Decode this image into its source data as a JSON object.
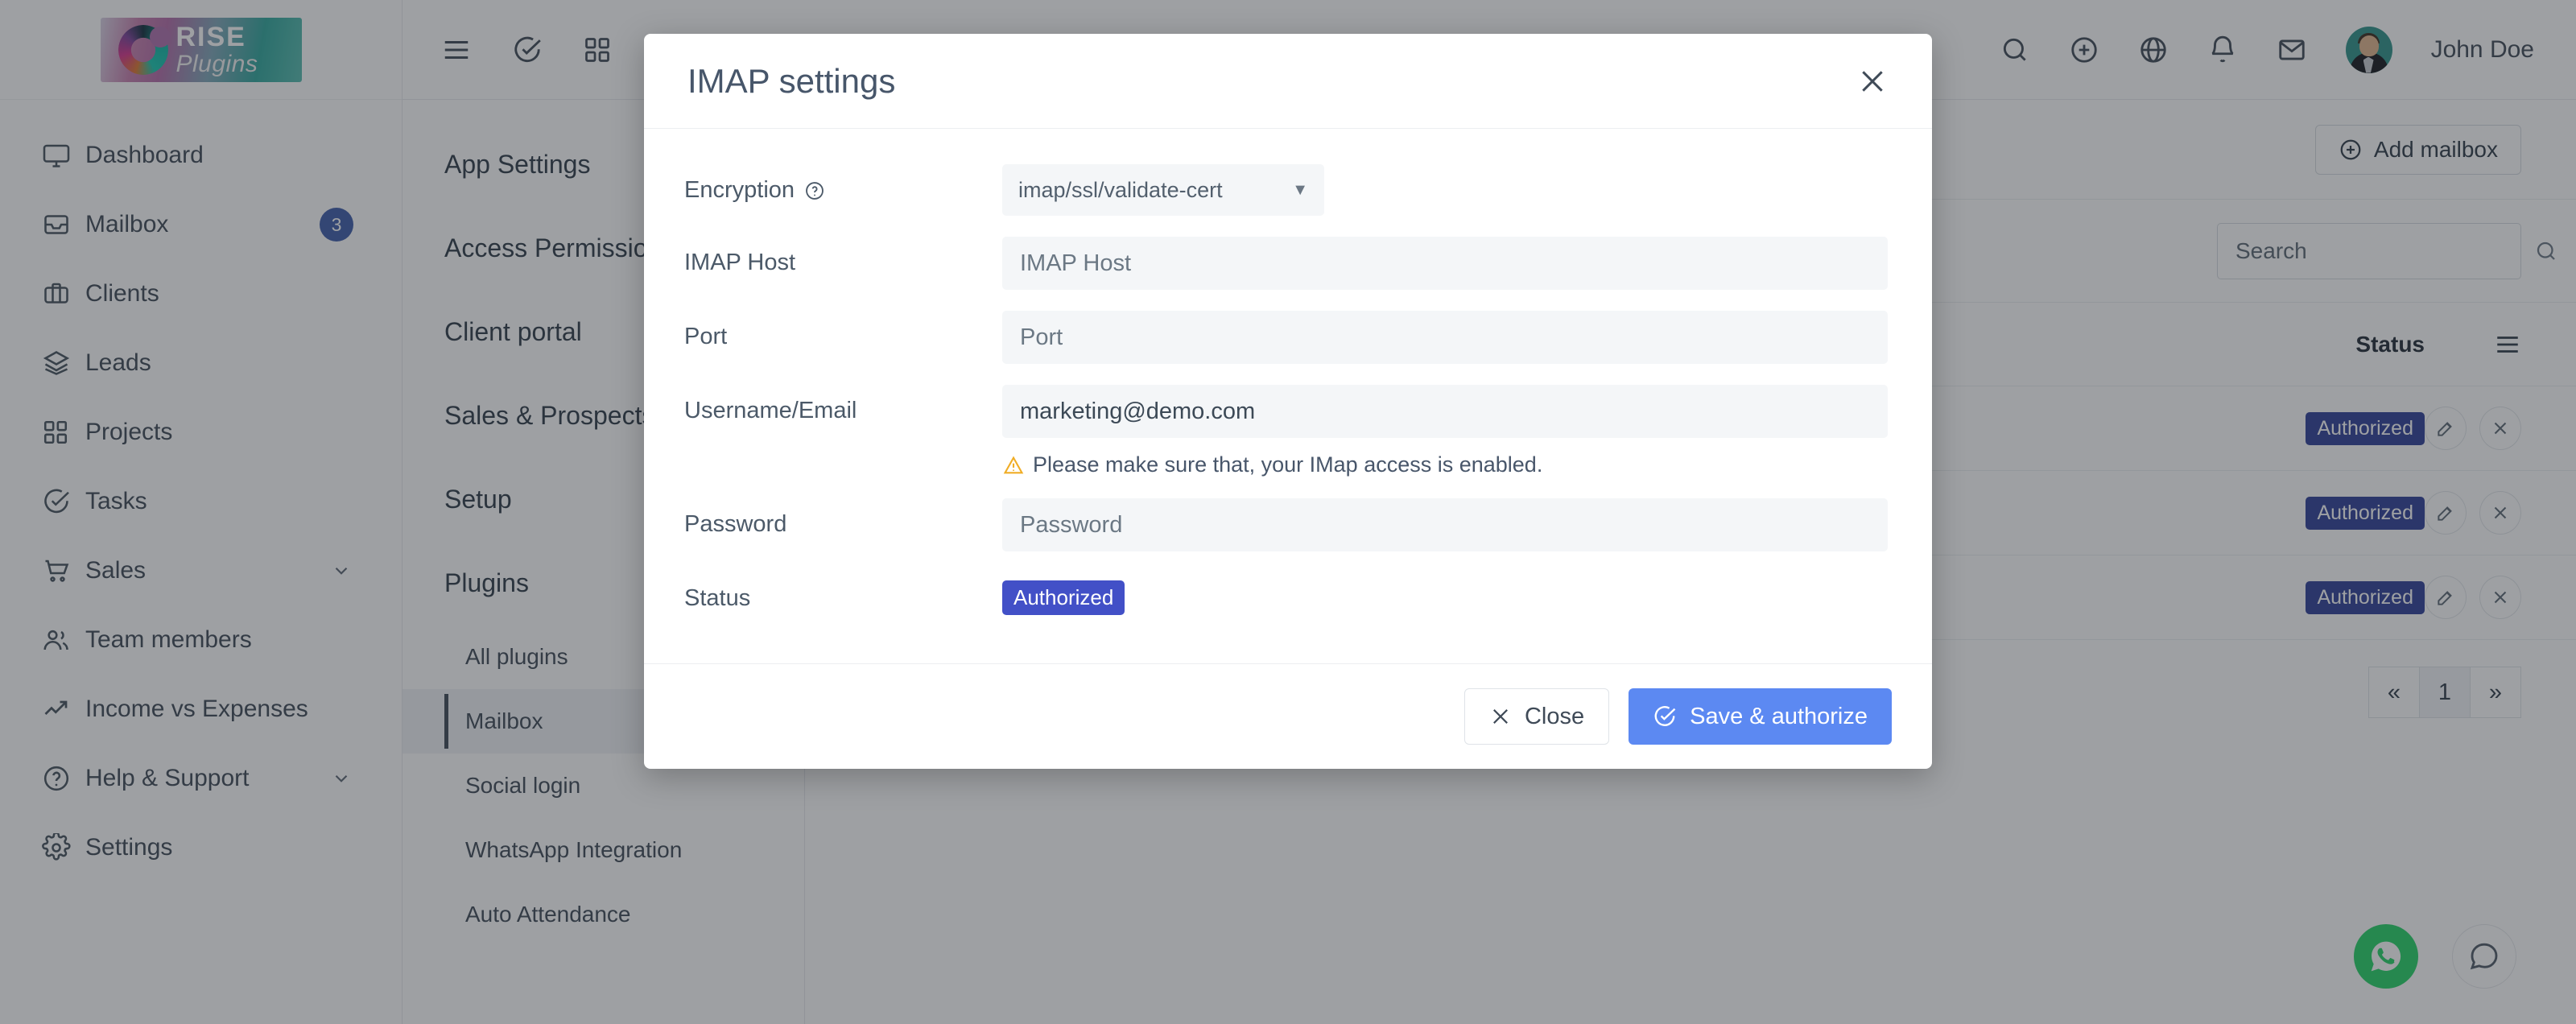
{
  "brand": {
    "name_top": "RISE",
    "name_bottom": "Plugins"
  },
  "sidebar": {
    "items": [
      {
        "label": "Dashboard",
        "icon": "monitor-icon",
        "badge": null,
        "caret": false
      },
      {
        "label": "Mailbox",
        "icon": "inbox-icon",
        "badge": "3",
        "caret": false
      },
      {
        "label": "Clients",
        "icon": "briefcase-icon",
        "badge": null,
        "caret": false
      },
      {
        "label": "Leads",
        "icon": "layers-icon",
        "badge": null,
        "caret": false
      },
      {
        "label": "Projects",
        "icon": "grid-icon",
        "badge": null,
        "caret": false
      },
      {
        "label": "Tasks",
        "icon": "check-circle-icon",
        "badge": null,
        "caret": false
      },
      {
        "label": "Sales",
        "icon": "shopping-cart-icon",
        "badge": null,
        "caret": true
      },
      {
        "label": "Team members",
        "icon": "users-icon",
        "badge": null,
        "caret": false
      },
      {
        "label": "Income vs Expenses",
        "icon": "trending-up-icon",
        "badge": null,
        "caret": false
      },
      {
        "label": "Help & Support",
        "icon": "question-circle-icon",
        "badge": null,
        "caret": true
      },
      {
        "label": "Settings",
        "icon": "gear-icon",
        "badge": null,
        "caret": false
      }
    ]
  },
  "topbar": {
    "left_icons": [
      "hamburger-icon",
      "check-circle-icon",
      "grid-icon"
    ],
    "right_icons": [
      "search-icon",
      "plus-circle-icon",
      "globe-icon",
      "bell-icon",
      "mail-icon"
    ],
    "user_name": "John Doe"
  },
  "settings_nav": {
    "items": [
      {
        "label": "App Settings",
        "type": "group"
      },
      {
        "label": "Access Permission",
        "type": "group"
      },
      {
        "label": "Client portal",
        "type": "group"
      },
      {
        "label": "Sales & Prospects",
        "type": "group"
      },
      {
        "label": "Setup",
        "type": "group"
      },
      {
        "label": "Plugins",
        "type": "group"
      }
    ],
    "sub_items": [
      {
        "label": "All plugins",
        "active": false
      },
      {
        "label": "Mailbox",
        "active": true
      },
      {
        "label": "Social login",
        "active": false
      },
      {
        "label": "WhatsApp Integration",
        "active": false
      },
      {
        "label": "Auto Attendance",
        "active": false
      }
    ]
  },
  "main": {
    "add_mailbox_label": "Add mailbox",
    "search_placeholder": "Search",
    "table": {
      "status_header": "Status",
      "rows": [
        {
          "status": "Authorized"
        },
        {
          "status": "Authorized"
        },
        {
          "status": "Authorized"
        }
      ]
    },
    "pagination": {
      "prev": "«",
      "current": "1",
      "next": "»"
    }
  },
  "modal": {
    "title": "IMAP settings",
    "fields": {
      "encryption_label": "Encryption",
      "encryption_value": "imap/ssl/validate-cert",
      "imap_host_label": "IMAP Host",
      "imap_host_placeholder": "IMAP Host",
      "imap_host_value": "",
      "port_label": "Port",
      "port_placeholder": "Port",
      "port_value": "",
      "username_label": "Username/Email",
      "username_placeholder": "Username/Email",
      "username_value": "marketing@demo.com",
      "hint": "Please make sure that, your IMap access is enabled.",
      "password_label": "Password",
      "password_placeholder": "Password",
      "password_value": "",
      "status_label": "Status",
      "status_value": "Authorized"
    },
    "close_label": "Close",
    "save_label": "Save & authorize"
  },
  "colors": {
    "primary_blue": "#5c89f2",
    "badge_indigo": "#2f3f97",
    "badge_modal": "#4250c7",
    "warning_amber": "#f0ad26",
    "whatsapp_green": "#25d366",
    "nav_badge_blue": "#3c5ba9"
  }
}
